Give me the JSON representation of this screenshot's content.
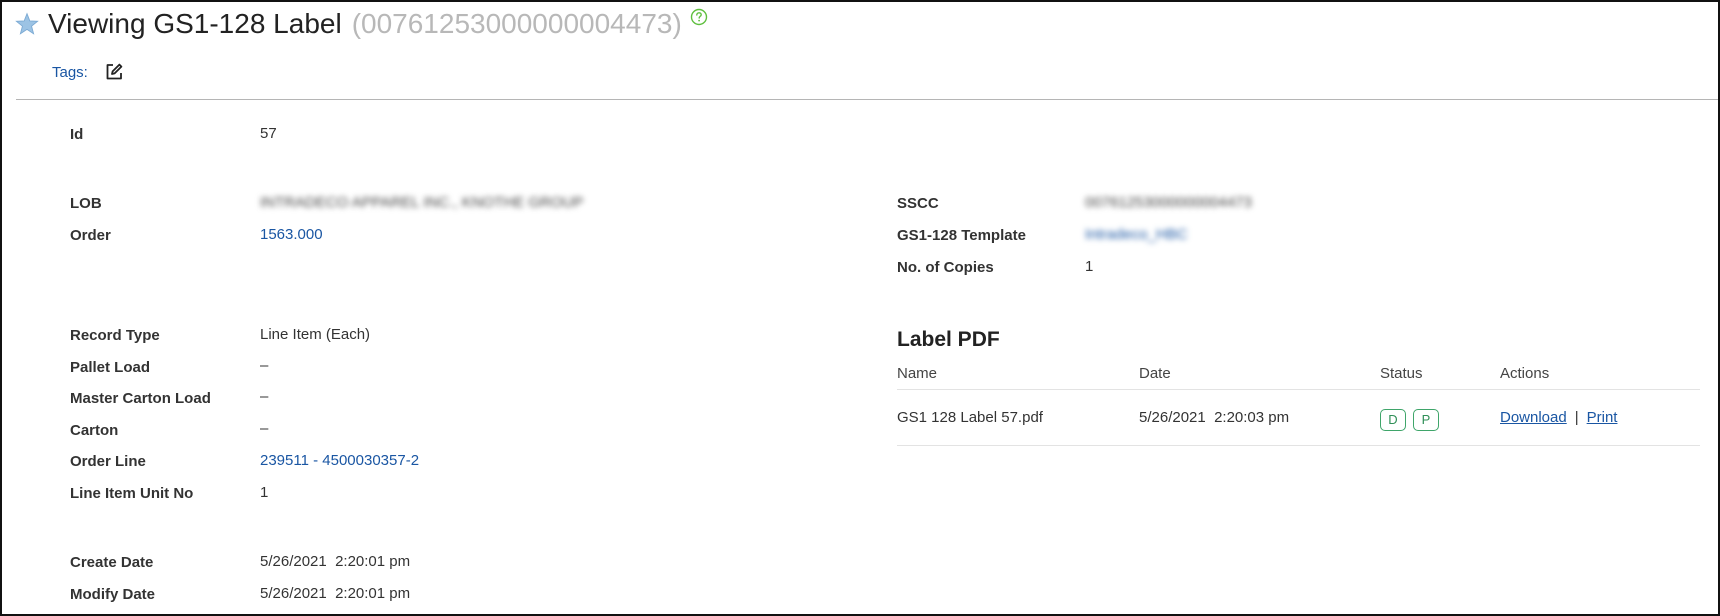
{
  "header": {
    "title": "Viewing GS1-128 Label",
    "id_text": "(00761253000000004473)"
  },
  "tags": {
    "label": "Tags:"
  },
  "fields": {
    "id": {
      "label": "Id",
      "value": "57"
    },
    "lob": {
      "label": "LOB",
      "value": "INTRADECO APPAREL INC., KNOTHE GROUP"
    },
    "order": {
      "label": "Order",
      "value": "1563.000"
    },
    "sscc": {
      "label": "SSCC",
      "value": "00761253000000004473"
    },
    "template": {
      "label": "GS1-128 Template",
      "value": "Intradeco_HBC"
    },
    "copies": {
      "label": "No. of Copies",
      "value": "1"
    },
    "record_type": {
      "label": "Record Type",
      "value": "Line Item (Each)"
    },
    "pallet_load": {
      "label": "Pallet Load",
      "value": "–"
    },
    "master_carton_load": {
      "label": "Master Carton Load",
      "value": "–"
    },
    "carton": {
      "label": "Carton",
      "value": "–"
    },
    "order_line": {
      "label": "Order Line",
      "value": "239511 - 4500030357-2"
    },
    "line_item_unit_no": {
      "label": "Line Item Unit No",
      "value": "1"
    },
    "create_date": {
      "label": "Create Date",
      "value": "5/26/2021  2:20:01 pm"
    },
    "modify_date": {
      "label": "Modify Date",
      "value": "5/26/2021  2:20:01 pm"
    }
  },
  "label_pdf": {
    "title": "Label PDF",
    "columns": [
      "Name",
      "Date",
      "Status",
      "Actions"
    ],
    "rows": [
      {
        "name": "GS1 128 Label 57.pdf",
        "date": "5/26/2021  2:20:03 pm",
        "status": [
          "D",
          "P"
        ],
        "actions": {
          "download": "Download",
          "separator": "|",
          "print": "Print"
        }
      }
    ]
  },
  "colors": {
    "link": "#1a56a3",
    "star": "#8fb8dc",
    "help": "#5fbf3f",
    "badge": "#3fa56a"
  },
  "icons": [
    "star-icon",
    "help-icon",
    "edit-icon"
  ]
}
